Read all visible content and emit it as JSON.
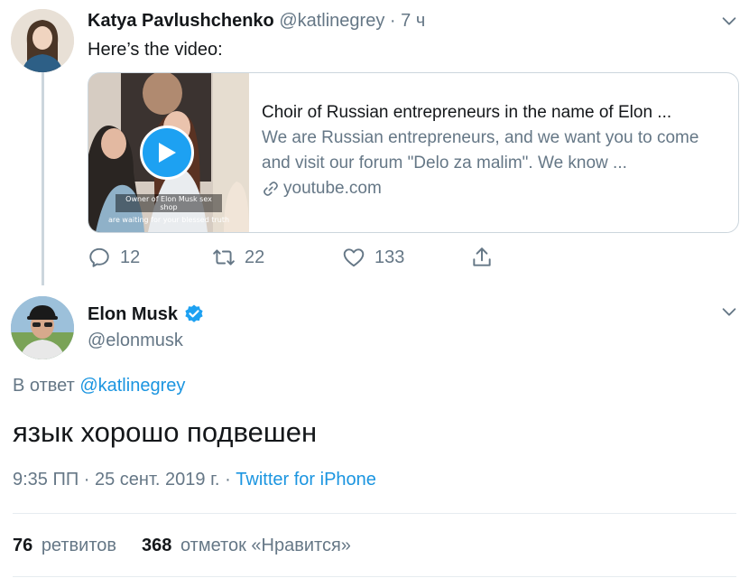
{
  "reply_tweet_parent": {
    "author_name": "Katya Pavlushchenko",
    "author_handle": "@katlinegrey",
    "separator": "·",
    "time": "7 ч",
    "text": "Here’s the video:",
    "card": {
      "title": "Choir of Russian entrepreneurs in the name of Elon ...",
      "description": "We are Russian entrepreneurs, and we want you to come and visit our forum \"Delo za malim\". We know ...",
      "domain": "youtube.com",
      "thumbnail_caption": "Owner of Elon Musk sex shop",
      "thumbnail_subtitle": "are waiting for your blessed truth"
    },
    "actions": {
      "replies": "12",
      "retweets": "22",
      "likes": "133"
    }
  },
  "main_tweet": {
    "author_name": "Elon Musk",
    "author_handle": "@elonmusk",
    "reply_prefix": "В ответ",
    "reply_to": "@katlinegrey",
    "text": "язык хорошо подвешен",
    "timestamp": "9:35 ПП · 25 сент. 2019 г.",
    "meta_separator": "·",
    "source": "Twitter for iPhone",
    "stats": {
      "retweets_count": "76",
      "retweets_label": "ретвитов",
      "likes_count": "368",
      "likes_label": "отметок «Нравится»"
    }
  },
  "colors": {
    "accent": "#1da1f2",
    "link": "#1b95e0",
    "secondary_text": "#657786",
    "border": "#ccd6dd"
  },
  "icons": [
    "chevron-down-icon",
    "play-icon",
    "link-icon",
    "reply-icon",
    "retweet-icon",
    "like-icon",
    "share-icon",
    "verified-badge-icon"
  ]
}
